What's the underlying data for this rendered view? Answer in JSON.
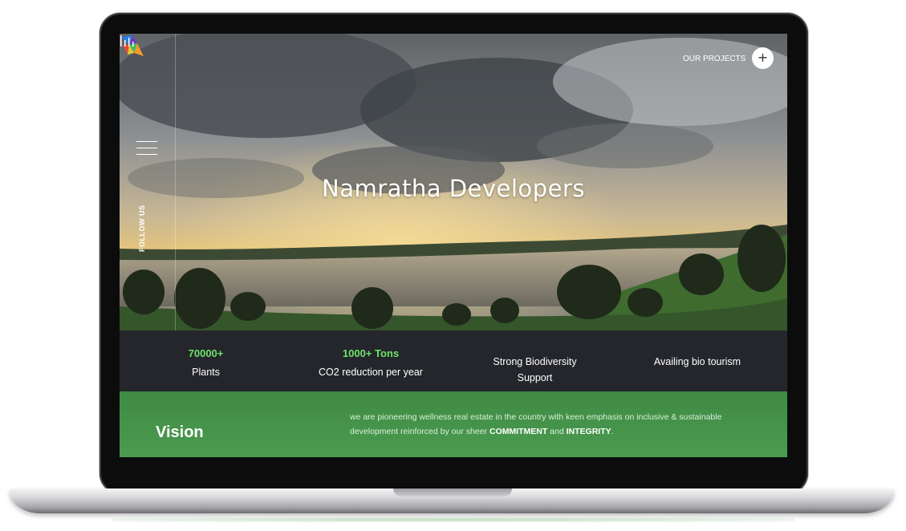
{
  "site": {
    "hero_title": "Namratha Developers",
    "follow_label": "FOLLOW US",
    "projects_label": "OUR PROJECTS",
    "plus_symbol": "+"
  },
  "stats": [
    {
      "number": "70000+",
      "label": "Plants"
    },
    {
      "number": "1000+ Tons",
      "label": "CO2 reduction per year"
    },
    {
      "label_line1": "Strong Biodiversity",
      "label_line2": "Support"
    },
    {
      "label": "Availing bio tourism"
    }
  ],
  "vision": {
    "title": "Vision",
    "text_part1": "we are pioneering wellness real estate in the country with keen emphasis on inclusive & sustainable development reinforced by our sheer ",
    "strong1": "COMMITMENT",
    "text_part2": " and ",
    "strong2": "INTEGRITY",
    "text_part3": "."
  },
  "colors": {
    "accent_green": "#6fe36a",
    "vision_green": "#4c9b50",
    "stats_bg": "#24262b"
  },
  "icons": [
    "logo-icon",
    "menu-icon",
    "plus-icon",
    "bars-icon"
  ]
}
